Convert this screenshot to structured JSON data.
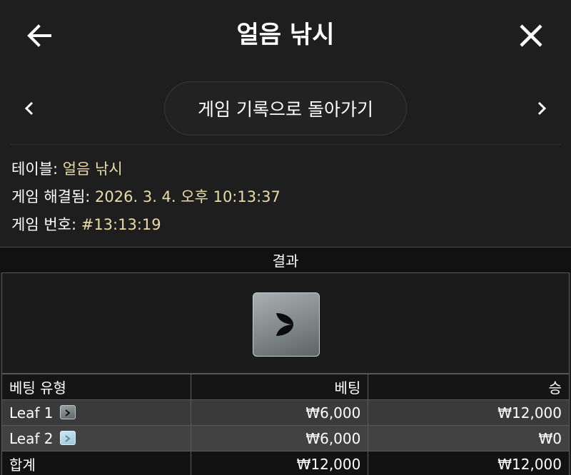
{
  "header": {
    "title": "얼음 낚시",
    "back_icon": "arrow-left-icon",
    "close_icon": "close-icon"
  },
  "nav": {
    "prev_icon": "chevron-left-icon",
    "next_icon": "chevron-right-icon",
    "back_to_history_label": "게임 기록으로 돌아가기"
  },
  "info": {
    "table_label": "테이블:",
    "table_value": "얼음 낚시",
    "resolved_label": "게임 해결됨:",
    "resolved_value": "2026. 3. 4. 오후 10:13:37",
    "game_no_label": "게임 번호:",
    "game_no_value": "#13:13:19"
  },
  "result": {
    "heading": "결과",
    "card_icon": "leaf-card-icon"
  },
  "bets": {
    "headers": [
      "베팅 유형",
      "베팅",
      "승"
    ],
    "rows": [
      {
        "type": "Leaf 1",
        "icon": "leaf-dark-icon",
        "bet": "₩6,000",
        "win": "₩12,000"
      },
      {
        "type": "Leaf 2",
        "icon": "leaf-light-icon",
        "bet": "₩6,000",
        "win": "₩0"
      }
    ],
    "total": {
      "label": "합계",
      "bet": "₩12,000",
      "win": "₩12,000"
    }
  },
  "colors": {
    "background": "#1e1e1e",
    "value_text": "#e9dcaa",
    "table_border": "#5a5a5a"
  }
}
